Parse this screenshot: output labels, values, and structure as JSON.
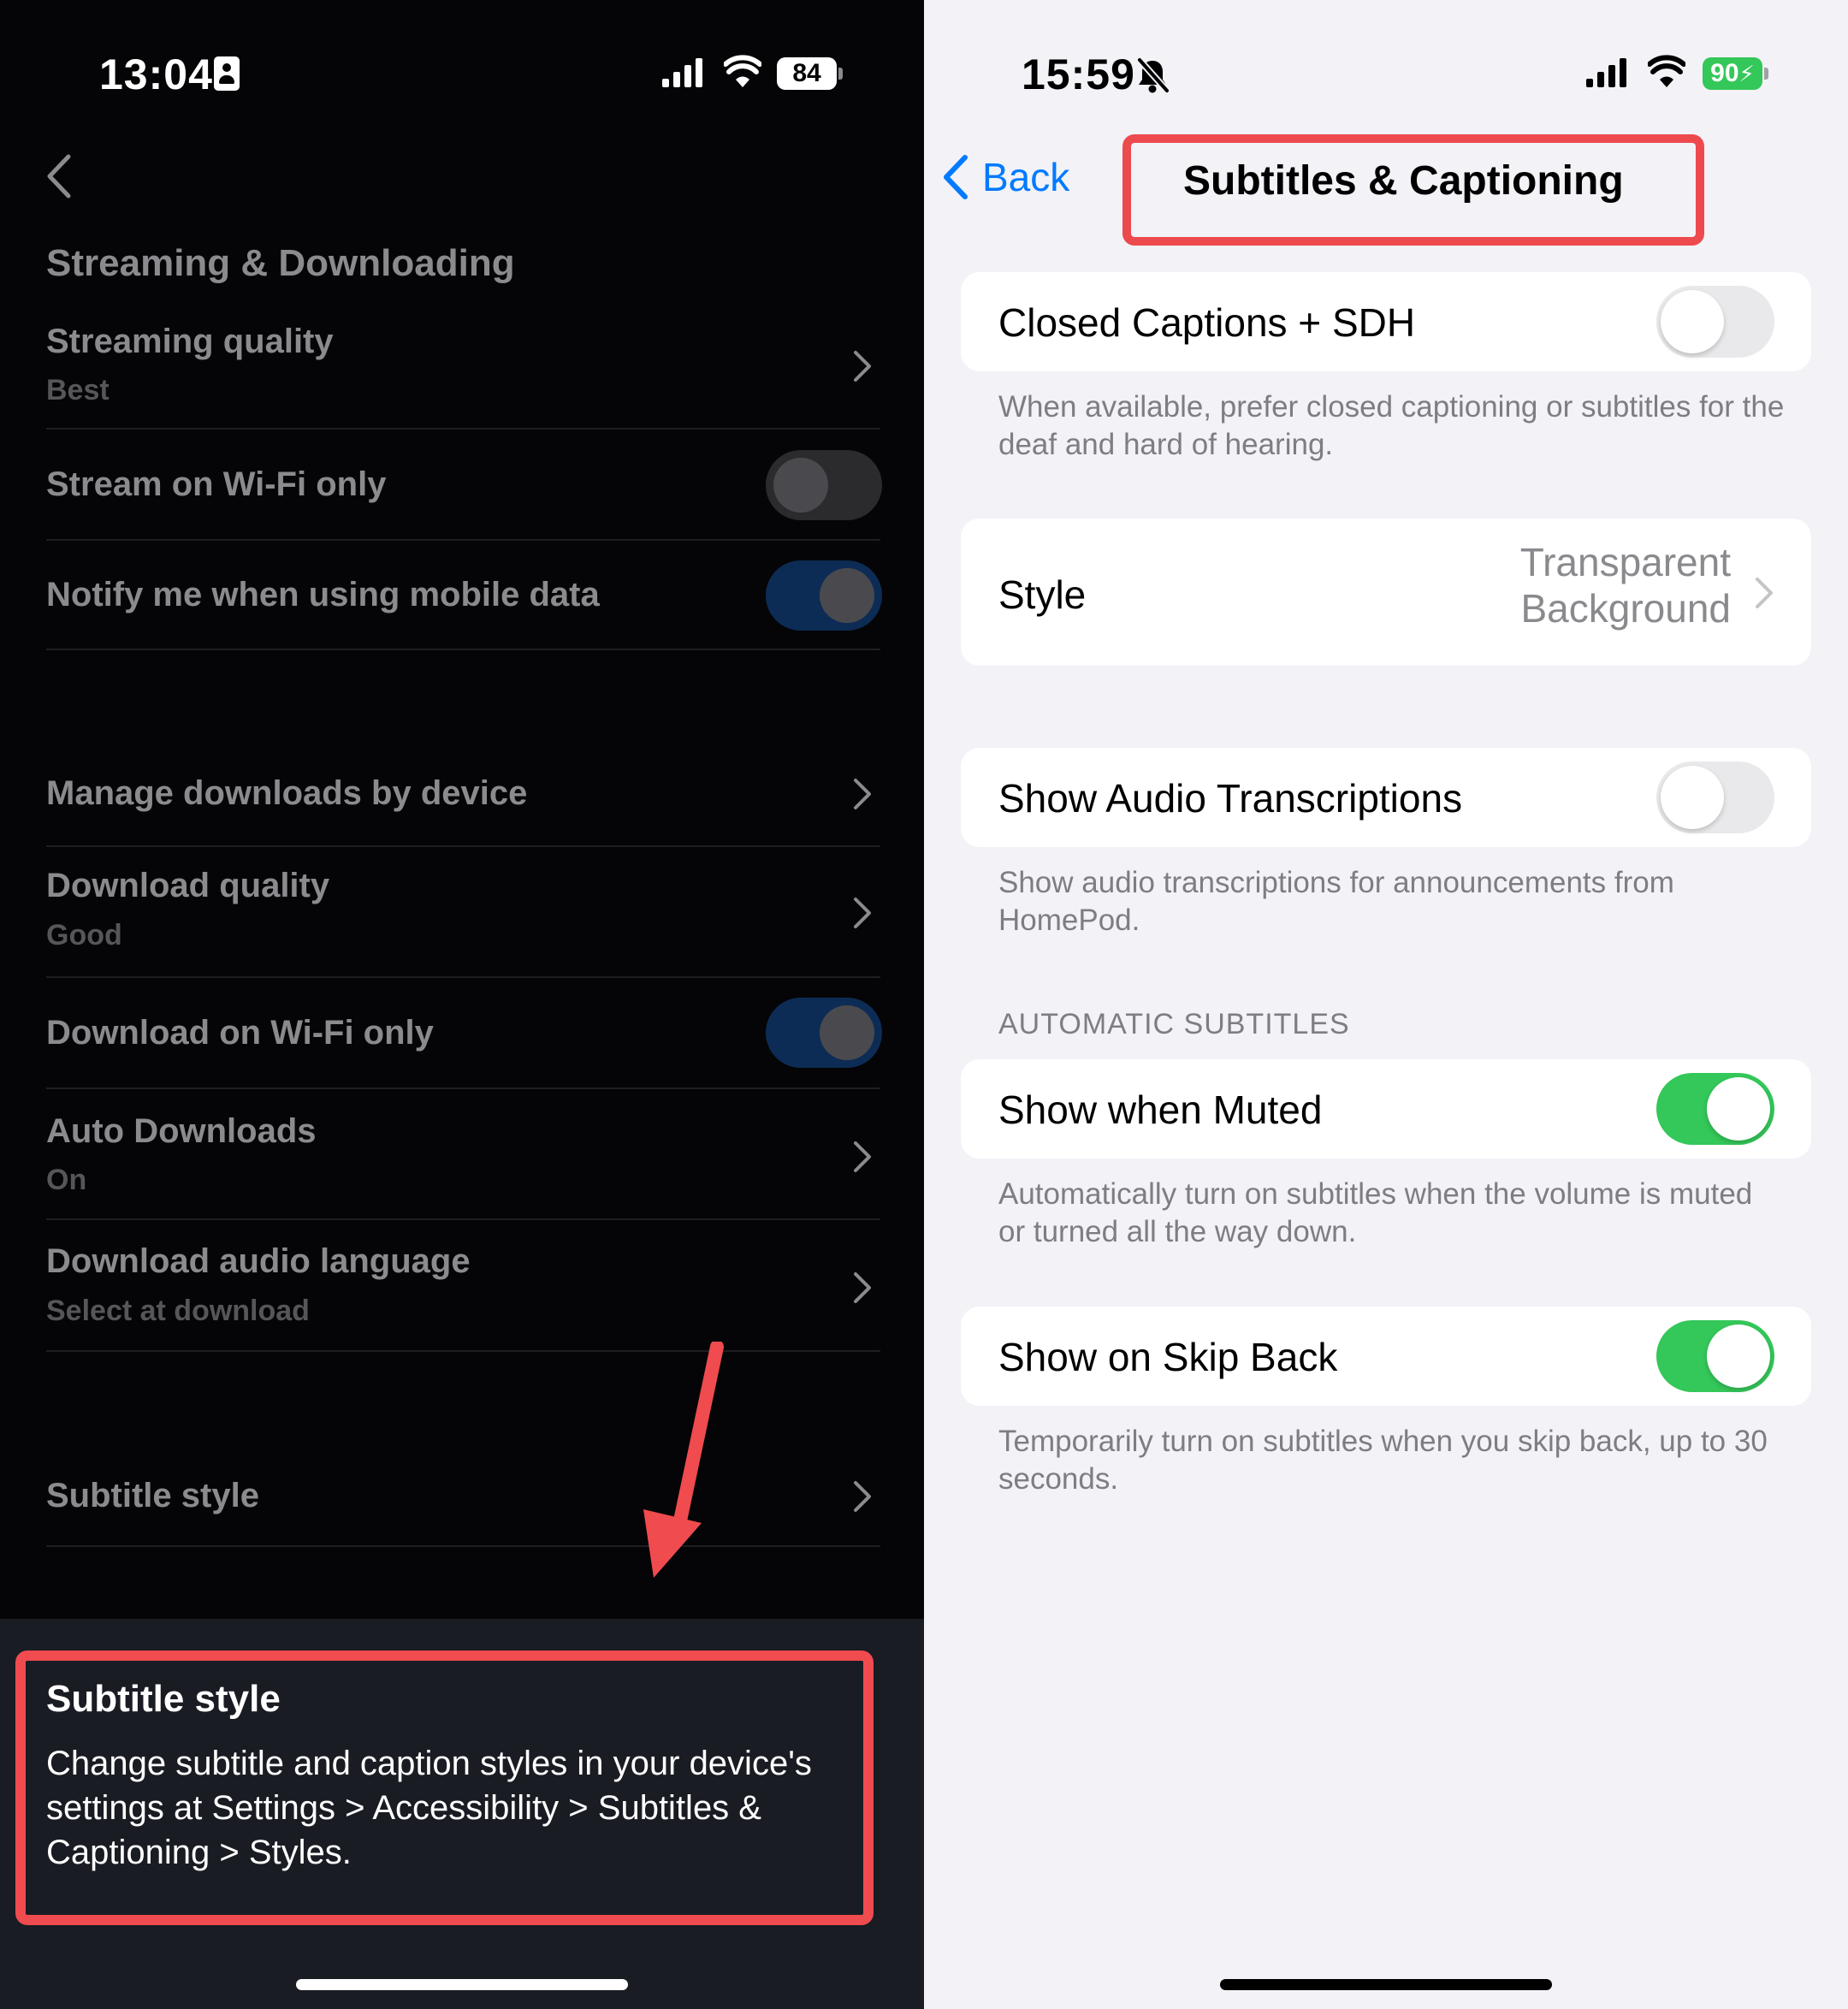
{
  "left": {
    "status": {
      "time": "13:04",
      "battery": "84"
    },
    "section_title": "Streaming & Downloading",
    "rows": [
      {
        "title": "Streaming quality",
        "subtitle": "Best"
      },
      {
        "title": "Stream on Wi-Fi only",
        "toggle": "off"
      },
      {
        "title": "Notify me when using mobile data",
        "toggle": "on"
      },
      {
        "title": "Manage downloads by device"
      },
      {
        "title": "Download quality",
        "subtitle": "Good"
      },
      {
        "title": "Download on Wi-Fi only",
        "toggle": "on"
      },
      {
        "title": "Auto Downloads",
        "subtitle": "On"
      },
      {
        "title": "Download audio language",
        "subtitle": "Select at download"
      },
      {
        "title": "Subtitle style"
      }
    ],
    "tooltip": {
      "title": "Subtitle style",
      "body": "Change subtitle and caption styles in your device's settings at Settings > Accessibility > Subtitles & Captioning > Styles."
    },
    "colors": {
      "background": "#050507",
      "tooltip_bg": "#1a1c24",
      "highlight": "#f04b4f"
    }
  },
  "right": {
    "status": {
      "time": "15:59",
      "battery": "90"
    },
    "nav": {
      "back_label": "Back",
      "title": "Subtitles & Captioning"
    },
    "closed_captions": {
      "label": "Closed Captions + SDH",
      "toggle": "off",
      "description": "When available, prefer closed captioning or subtitles for the deaf and hard of hearing."
    },
    "style": {
      "label": "Style",
      "value_line1": "Transparent",
      "value_line2": "Background"
    },
    "audio_transcriptions": {
      "label": "Show Audio Transcriptions",
      "toggle": "off",
      "description": "Show audio transcriptions for announcements from HomePod."
    },
    "automatic_subtitles_header": "AUTOMATIC SUBTITLES",
    "show_when_muted": {
      "label": "Show when Muted",
      "toggle": "on",
      "description": "Automatically turn on subtitles when the volume is muted or turned all the way down."
    },
    "show_on_skip_back": {
      "label": "Show on Skip Back",
      "toggle": "on",
      "description": "Temporarily turn on subtitles when you skip back, up to 30 seconds."
    },
    "colors": {
      "background": "#f2f2f7",
      "accent": "#007aff",
      "toggle_on": "#34c759",
      "highlight": "#ed4a4e"
    }
  }
}
